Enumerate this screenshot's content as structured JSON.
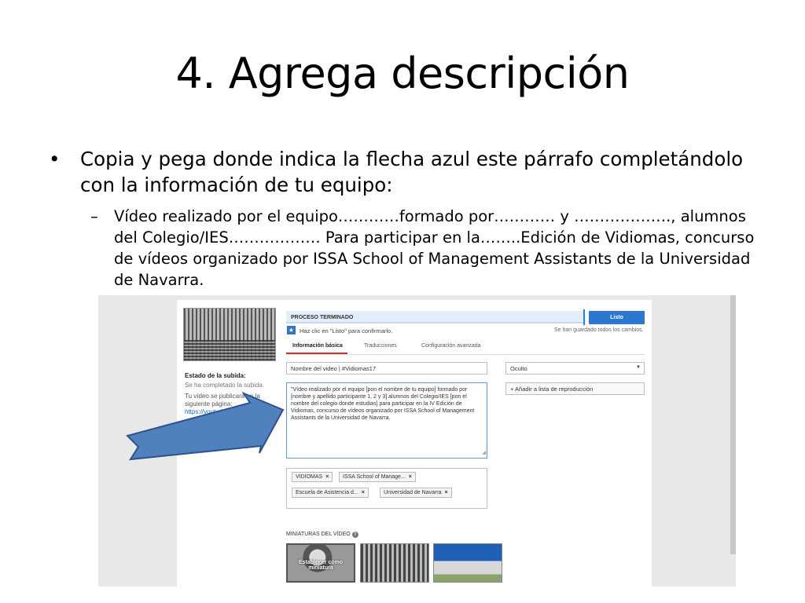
{
  "slide": {
    "title": "4. Agrega descripción",
    "bullet_main": "Copia y pega donde indica la flecha azul este párrafo completándolo con la información de tu equipo:",
    "bullet_sub": "Vídeo realizado por el equipo…………formado por………… y ………………., alumnos del Colegio/IES……………… Para participar en la……..Edición de Vidiomas, concurso de vídeos organizado por ISSA School of Management Assistants de la Universidad de Navarra."
  },
  "editor": {
    "process_label": "PROCESO TERMINADO",
    "done_button": "Listo",
    "confirm_text": "Haz clic en \"Listo\" para confirmarlo.",
    "saved_text": "Se han guardado todos los cambios.",
    "tabs": [
      "Información básica",
      "Traducciones",
      "Configuración avanzada"
    ],
    "upload": {
      "heading": "Estado de la subida:",
      "completed": "Se ha completado la subida.",
      "published_text": "Tu vídeo se publicará en la siguiente página:",
      "link": "https://youtu.be/y3Vg0Ut"
    },
    "title_value": "Nombre del video | #Vidiomas17",
    "visibility": "Oculto",
    "add_playlist": "+ Añadir a lista de reproducción",
    "description": "\"Vídeo realizado por el equipo [pon el nombre de tu equipo] formado por [nombre y apellido participante 1, 2 y 3] alumnos del Colegio/IES [pon el nombre del colegio donde estudias] para participar en la IV Edición de Vidiomas, concurso de vídeos organizado por ISSA School of Management Assistants de la Universidad de Navarra.",
    "tags": [
      "VIDIOMAS",
      "ISSA School of Manage...",
      "Escuela de Asistencia d...",
      "Universidad de Navarra"
    ],
    "thumbnails_label": "MINIATURAS DEL VÍDEO",
    "set_thumbnail": "Establecer como miniatura"
  },
  "colors": {
    "arrow_fill": "#4f81bd",
    "arrow_stroke": "#2f528f",
    "accent_blue": "#2c78d0",
    "tab_underline": "#d32f2f"
  }
}
